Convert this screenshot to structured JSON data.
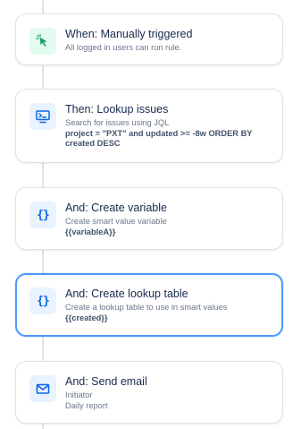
{
  "steps": [
    {
      "title": "When: Manually triggered",
      "description": "All logged in users can run rule.",
      "icon": "cursor-click-icon",
      "icon_color": "#22a06b"
    },
    {
      "title": "Then: Lookup issues",
      "description": "Search for issues using JQL",
      "detail": "project = \"PXT\" and updated >= -8w ORDER BY created DESC",
      "icon": "monitor-search-icon",
      "icon_color": "#0c66e4"
    },
    {
      "title": "And: Create variable",
      "description": "Create smart value variable",
      "detail": "{{variableA}}",
      "icon": "braces-icon",
      "icon_glyph": "{}",
      "icon_color": "#0c66e4"
    },
    {
      "title": "And: Create lookup table",
      "description": "Create a lookup table to use in smart values",
      "detail": "{{created}}",
      "icon": "braces-icon",
      "icon_glyph": "{}",
      "icon_color": "#0c66e4",
      "selected": true
    },
    {
      "title": "And: Send email",
      "description": "Initiator",
      "detail": "Daily report",
      "icon": "envelope-icon",
      "icon_color": "#0c66e4"
    }
  ],
  "colors": {
    "selected_border": "#4c9aff",
    "connector": "#dfe1e6",
    "title_text": "#172b4d",
    "secondary_text": "#6b778c"
  }
}
